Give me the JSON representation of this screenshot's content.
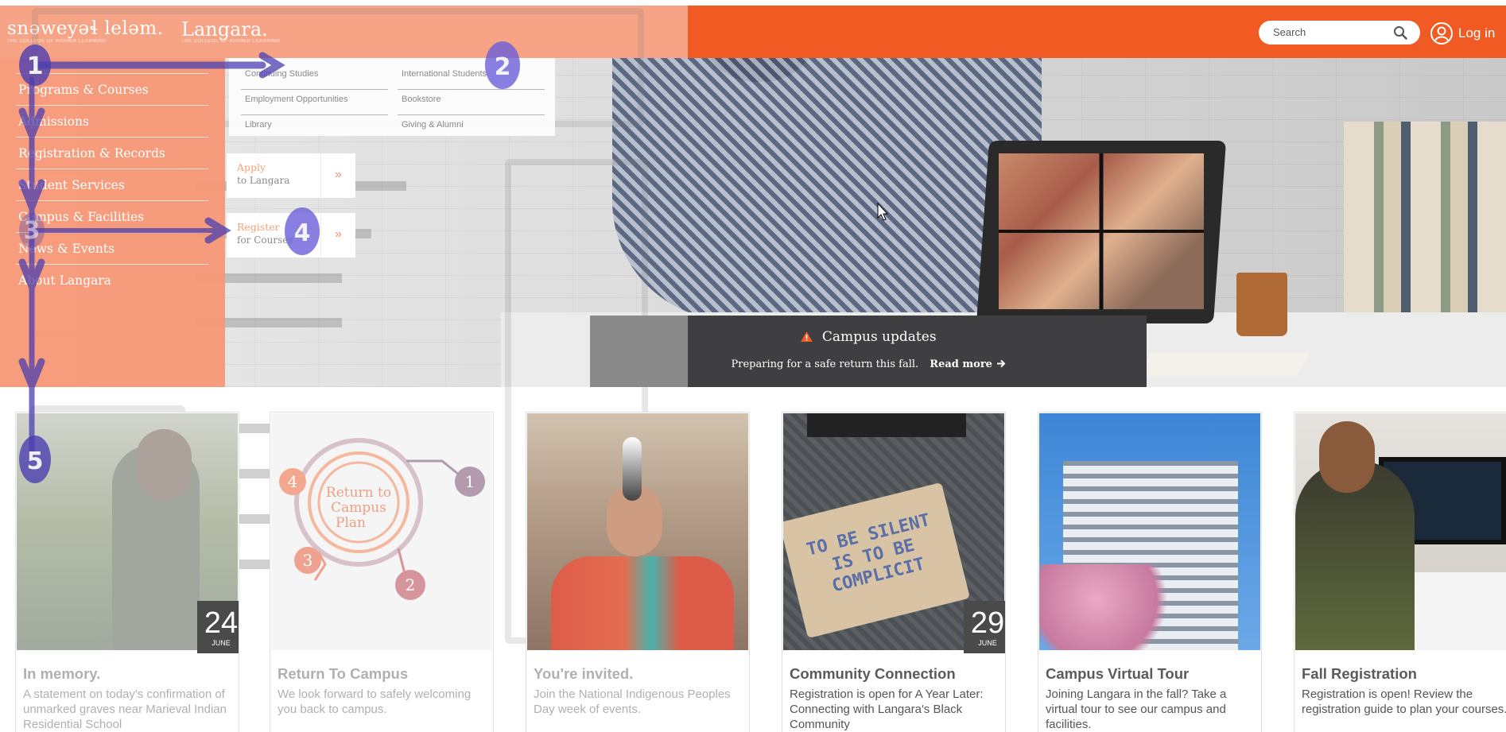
{
  "header": {
    "logo_primary": "snəweyəɬ leləm.",
    "logo_primary_tagline": "THE COLLEGE OF HIGHER LEARNING",
    "logo_secondary": "Langara.",
    "logo_secondary_tagline": "THE COLLEGE OF HIGHER LEARNING",
    "search_placeholder": "Search",
    "search_icon": "magnifier-icon",
    "login_label": "Log in",
    "login_icon": "user-circle-icon",
    "brand_color": "#f15a22"
  },
  "nav": {
    "items": [
      {
        "label": "Programs & Courses"
      },
      {
        "label": "Admissions"
      },
      {
        "label": "Registration & Records"
      },
      {
        "label": "Student Services"
      },
      {
        "label": "Campus & Facilities"
      },
      {
        "label": "News & Events"
      },
      {
        "label": "About Langara"
      }
    ],
    "sub_links_left": [
      "Continuing Studies",
      "Employment Opportunities",
      "Library"
    ],
    "sub_links_right": [
      "International Students",
      "Bookstore",
      "Giving & Alumni"
    ],
    "cta_apply": {
      "line1": "Apply",
      "line2": "to Langara",
      "arrow": "»"
    },
    "cta_register": {
      "line1": "Register",
      "line2": "for Courses",
      "arrow": "»"
    }
  },
  "annotations": {
    "markers": [
      "1",
      "2",
      "3",
      "4",
      "5"
    ],
    "color": "#4b3fb0"
  },
  "updates": {
    "title": "Campus updates",
    "text": "Preparing for a safe return this fall.",
    "link": "Read more",
    "icon": "warning-triangle-icon"
  },
  "cards": [
    {
      "title": "In memory.",
      "text": "A statement on today's confirmation of unmarked graves near Marieval Indian Residential School",
      "day": "24",
      "month": "JUNE"
    },
    {
      "title": "Return To Campus",
      "text": "We look forward to safely welcoming you back to campus.",
      "graphic_title": "Return to Campus Plan",
      "graphic_steps": [
        "1",
        "2",
        "3",
        "4"
      ]
    },
    {
      "title": "You're invited.",
      "text": "Join the National Indigenous Peoples Day week of events."
    },
    {
      "title": "Community Connection",
      "text": "Registration is open for A Year Later: Connecting with Langara's Black Community",
      "day": "29",
      "month": "JUNE",
      "sign_text": "TO BE SILENT IS TO BE COMPLICIT"
    },
    {
      "title": "Campus Virtual Tour",
      "text": "Joining Langara in the fall? Take a virtual tour to see our campus and facilities."
    },
    {
      "title": "Fall Registration",
      "text": "Registration is open! Review the registration guide to plan your courses."
    }
  ]
}
